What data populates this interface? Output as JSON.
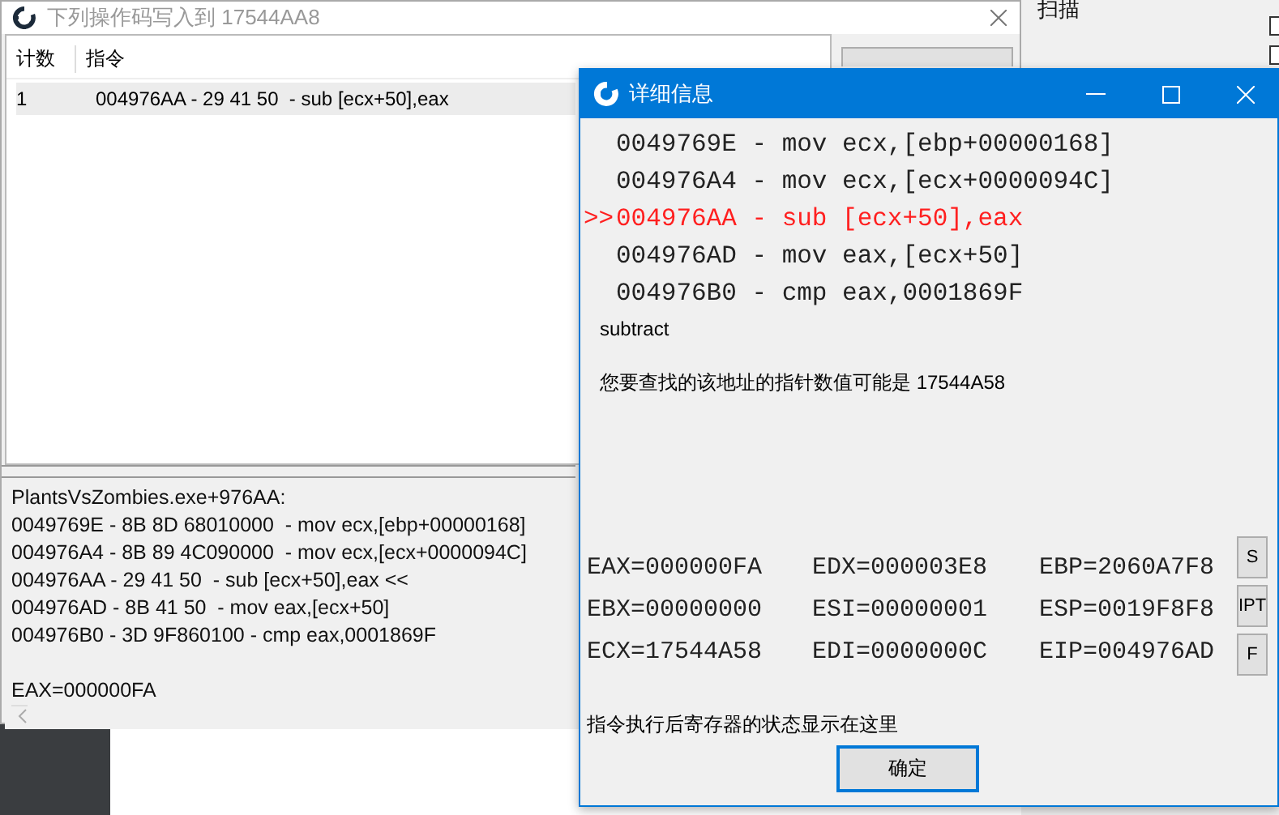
{
  "background_window": {
    "text": "扫描",
    "checkboxes": [
      {
        "checked": false
      },
      {
        "checked": false
      }
    ]
  },
  "opcode_window": {
    "title": "下列操作码写入到 17544AA8",
    "columns": [
      "计数",
      "指令"
    ],
    "rows": [
      {
        "cells": [
          "1",
          "004976AA - 29 41 50  - sub [ecx+50],eax"
        ],
        "selected": true
      }
    ],
    "disassembly": [
      "PlantsVsZombies.exe+976AA:",
      "0049769E - 8B 8D 68010000  - mov ecx,[ebp+00000168]",
      "004976A4 - 8B 89 4C090000  - mov ecx,[ecx+0000094C]",
      "004976AA - 29 41 50  - sub [ecx+50],eax <<",
      "004976AD - 8B 41 50  - mov eax,[ecx+50]",
      "004976B0 - 3D 9F860100 - cmp eax,0001869F"
    ],
    "register": "EAX=000000FA"
  },
  "detail_window": {
    "title": "详细信息",
    "code": [
      {
        "text": "0049769E - mov ecx,[ebp+00000168]",
        "current": false
      },
      {
        "text": "004976A4 - mov ecx,[ecx+0000094C]",
        "current": false
      },
      {
        "marker": ">>",
        "text": "004976AA - sub [ecx+50],eax",
        "current": true
      },
      {
        "text": "004976AD - mov eax,[ecx+50]",
        "current": false
      },
      {
        "text": "004976B0 - cmp eax,0001869F",
        "current": false
      }
    ],
    "description": "subtract",
    "pointer_hint": "您要查找的该地址的指针数值可能是 17544A58",
    "registers": [
      [
        "EAX=000000FA",
        "EDX=000003E8",
        "EBP=2060A7F8"
      ],
      [
        "EBX=00000000",
        "ESI=00000001",
        "ESP=0019F8F8"
      ],
      [
        "ECX=17544A58",
        "EDI=0000000C",
        "EIP=004976AD"
      ]
    ],
    "side_buttons": [
      "S",
      "IPT",
      "F"
    ],
    "status": "指令执行后寄存器的状态显示在这里",
    "ok_button": "确定"
  }
}
